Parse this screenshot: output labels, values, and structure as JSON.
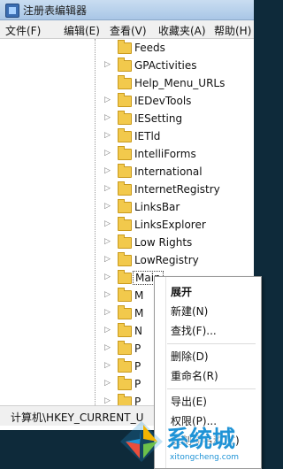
{
  "window": {
    "title": "注册表编辑器"
  },
  "menubar": [
    {
      "label": "文件(F)"
    },
    {
      "label": "编辑(E)"
    },
    {
      "label": "查看(V)"
    },
    {
      "label": "收藏夹(A)"
    },
    {
      "label": "帮助(H)"
    }
  ],
  "tree": {
    "items": [
      {
        "label": "Feeds",
        "has_children": false
      },
      {
        "label": "GPActivities",
        "has_children": true
      },
      {
        "label": "Help_Menu_URLs",
        "has_children": false
      },
      {
        "label": "IEDevTools",
        "has_children": true
      },
      {
        "label": "IESetting",
        "has_children": true
      },
      {
        "label": "IETld",
        "has_children": true
      },
      {
        "label": "IntelliForms",
        "has_children": true
      },
      {
        "label": "International",
        "has_children": true
      },
      {
        "label": "InternetRegistry",
        "has_children": true
      },
      {
        "label": "LinksBar",
        "has_children": true
      },
      {
        "label": "LinksExplorer",
        "has_children": true
      },
      {
        "label": "Low Rights",
        "has_children": true
      },
      {
        "label": "LowRegistry",
        "has_children": true
      },
      {
        "label": "Main",
        "has_children": true,
        "selected": true
      },
      {
        "label": "M",
        "has_children": true
      },
      {
        "label": "M",
        "has_children": true
      },
      {
        "label": "N",
        "has_children": true
      },
      {
        "label": "P",
        "has_children": true
      },
      {
        "label": "P",
        "has_children": true
      },
      {
        "label": "P",
        "has_children": true
      },
      {
        "label": "P",
        "has_children": true
      }
    ]
  },
  "statusbar": {
    "path": "计算机\\HKEY_CURRENT_U"
  },
  "context_menu": {
    "items": [
      {
        "label": "展开",
        "bold": true
      },
      {
        "label": "新建(N)"
      },
      {
        "label": "查找(F)..."
      },
      {
        "label": "删除(D)"
      },
      {
        "label": "重命名(R)"
      },
      {
        "label": "导出(E)"
      },
      {
        "label": "权限(P)..."
      },
      {
        "label": "复制项名称(C)"
      }
    ]
  },
  "watermark": {
    "brand": "系统城",
    "url": "xitongcheng.com"
  },
  "colors": {
    "folder": "#f2c94c",
    "titlebar": "#b9d1ea",
    "watermark_blue": "#1f93d6"
  }
}
